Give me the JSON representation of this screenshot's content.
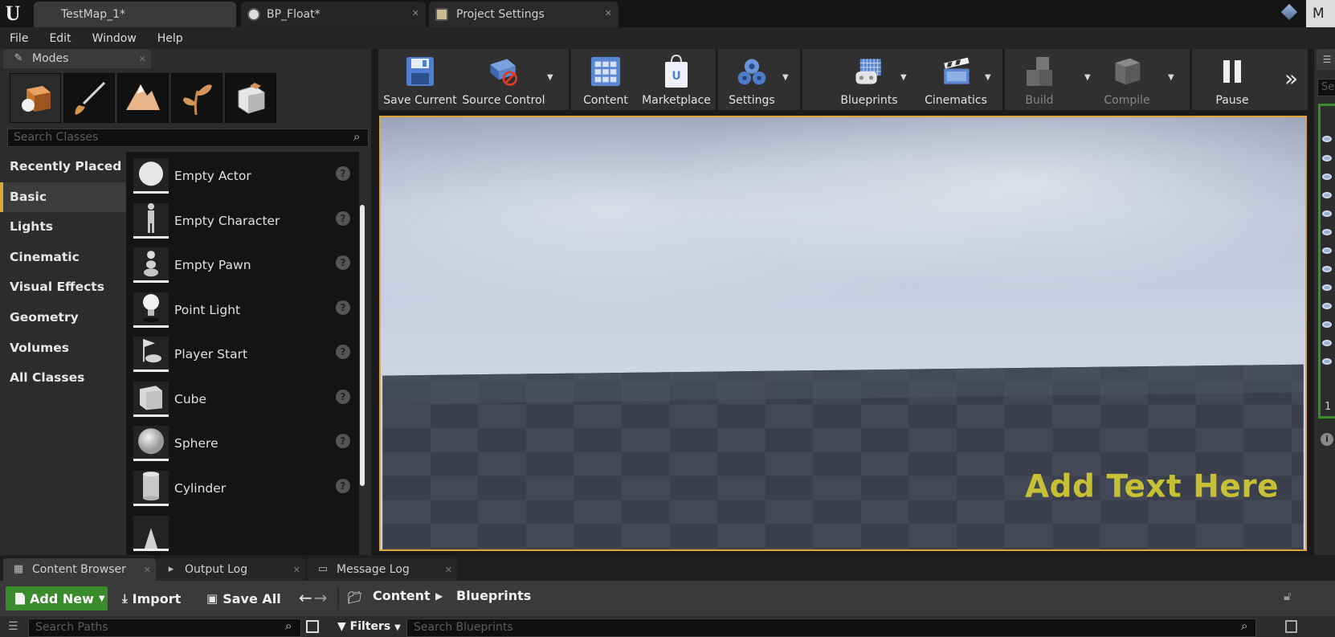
{
  "window": {
    "tabs": [
      {
        "label": "TestMap_1*"
      },
      {
        "label": "BP_Float*"
      },
      {
        "label": "Project Settings"
      }
    ],
    "right_label": "M"
  },
  "menu": [
    "File",
    "Edit",
    "Window",
    "Help"
  ],
  "modes_panel": {
    "title": "Modes",
    "mode_icons": [
      "place-mode-icon",
      "paint-mode-icon",
      "landscape-mode-icon",
      "foliage-mode-icon",
      "geometry-mode-icon"
    ],
    "search_placeholder": "Search Classes",
    "categories": [
      "Recently Placed",
      "Basic",
      "Lights",
      "Cinematic",
      "Visual Effects",
      "Geometry",
      "Volumes",
      "All Classes"
    ],
    "active_category": "Basic",
    "items": [
      {
        "label": "Empty Actor"
      },
      {
        "label": "Empty Character"
      },
      {
        "label": "Empty Pawn"
      },
      {
        "label": "Point Light"
      },
      {
        "label": "Player Start"
      },
      {
        "label": "Cube"
      },
      {
        "label": "Sphere"
      },
      {
        "label": "Cylinder"
      }
    ]
  },
  "toolbar": {
    "buttons": [
      {
        "label": "Save Current"
      },
      {
        "label": "Source Control"
      },
      {
        "label": "Content"
      },
      {
        "label": "Marketplace"
      },
      {
        "label": "Settings"
      },
      {
        "label": "Blueprints"
      },
      {
        "label": "Cinematics"
      },
      {
        "label": "Build"
      },
      {
        "label": "Compile"
      },
      {
        "label": "Pause"
      }
    ]
  },
  "viewport": {
    "text": "Add Text Here",
    "text_color": "#c6c035",
    "border_color": "#d9a73a"
  },
  "right_strip": {
    "search_placeholder": "Se",
    "count": "1"
  },
  "bottom": {
    "tabs": [
      {
        "label": "Content Browser"
      },
      {
        "label": "Output Log"
      },
      {
        "label": "Message Log"
      }
    ],
    "add_new": "Add New",
    "import": "Import",
    "save_all": "Save All",
    "breadcrumb": [
      "Content",
      "Blueprints"
    ],
    "search_paths_placeholder": "Search Paths",
    "filters": "Filters",
    "search_blueprints_placeholder": "Search Blueprints"
  },
  "colors": {
    "accent": "#d9a73a",
    "add_new_green": "#3a8b2c"
  }
}
